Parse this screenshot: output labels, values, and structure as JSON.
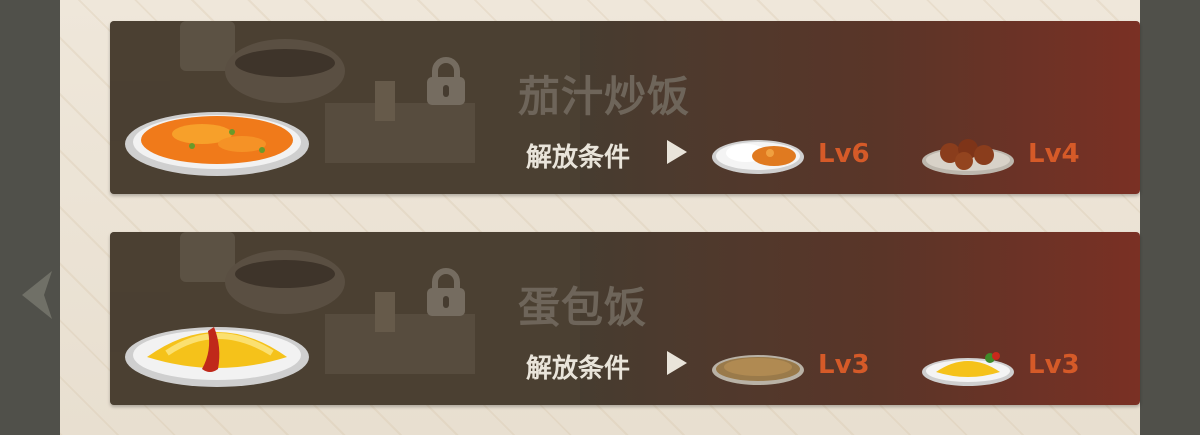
{
  "recipes": [
    {
      "name": "茄汁炒饭",
      "unlock_label": "解放条件",
      "dish": "tomato-fried-rice",
      "requirements": [
        {
          "dish": "curry-rice",
          "level": "Lv6"
        },
        {
          "dish": "karaage-chicken",
          "level": "Lv4"
        }
      ]
    },
    {
      "name": "蛋包饭",
      "unlock_label": "解放条件",
      "dish": "omurice",
      "requirements": [
        {
          "dish": "fried-rice",
          "level": "Lv3"
        },
        {
          "dish": "omelet",
          "level": "Lv3"
        }
      ]
    }
  ],
  "colors": {
    "card_dark": "#463c30",
    "card_red": "#7a3024",
    "level_text": "#d55a28",
    "locked_name": "#6e655a",
    "label_text": "#e9e4da"
  }
}
